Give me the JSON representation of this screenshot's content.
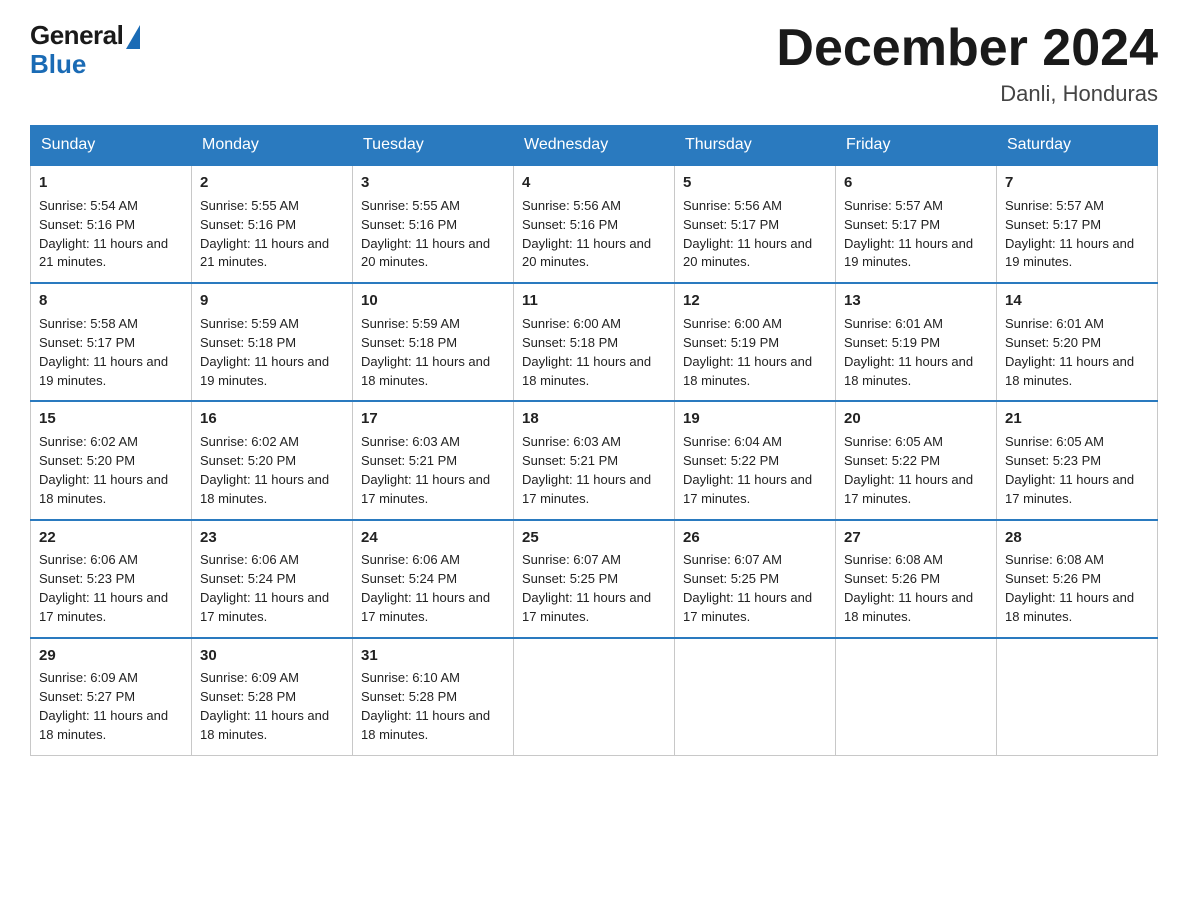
{
  "logo": {
    "general": "General",
    "blue": "Blue"
  },
  "title": "December 2024",
  "location": "Danli, Honduras",
  "days_of_week": [
    "Sunday",
    "Monday",
    "Tuesday",
    "Wednesday",
    "Thursday",
    "Friday",
    "Saturday"
  ],
  "weeks": [
    [
      {
        "day": "1",
        "sunrise": "5:54 AM",
        "sunset": "5:16 PM",
        "daylight": "11 hours and 21 minutes."
      },
      {
        "day": "2",
        "sunrise": "5:55 AM",
        "sunset": "5:16 PM",
        "daylight": "11 hours and 21 minutes."
      },
      {
        "day": "3",
        "sunrise": "5:55 AM",
        "sunset": "5:16 PM",
        "daylight": "11 hours and 20 minutes."
      },
      {
        "day": "4",
        "sunrise": "5:56 AM",
        "sunset": "5:16 PM",
        "daylight": "11 hours and 20 minutes."
      },
      {
        "day": "5",
        "sunrise": "5:56 AM",
        "sunset": "5:17 PM",
        "daylight": "11 hours and 20 minutes."
      },
      {
        "day": "6",
        "sunrise": "5:57 AM",
        "sunset": "5:17 PM",
        "daylight": "11 hours and 19 minutes."
      },
      {
        "day": "7",
        "sunrise": "5:57 AM",
        "sunset": "5:17 PM",
        "daylight": "11 hours and 19 minutes."
      }
    ],
    [
      {
        "day": "8",
        "sunrise": "5:58 AM",
        "sunset": "5:17 PM",
        "daylight": "11 hours and 19 minutes."
      },
      {
        "day": "9",
        "sunrise": "5:59 AM",
        "sunset": "5:18 PM",
        "daylight": "11 hours and 19 minutes."
      },
      {
        "day": "10",
        "sunrise": "5:59 AM",
        "sunset": "5:18 PM",
        "daylight": "11 hours and 18 minutes."
      },
      {
        "day": "11",
        "sunrise": "6:00 AM",
        "sunset": "5:18 PM",
        "daylight": "11 hours and 18 minutes."
      },
      {
        "day": "12",
        "sunrise": "6:00 AM",
        "sunset": "5:19 PM",
        "daylight": "11 hours and 18 minutes."
      },
      {
        "day": "13",
        "sunrise": "6:01 AM",
        "sunset": "5:19 PM",
        "daylight": "11 hours and 18 minutes."
      },
      {
        "day": "14",
        "sunrise": "6:01 AM",
        "sunset": "5:20 PM",
        "daylight": "11 hours and 18 minutes."
      }
    ],
    [
      {
        "day": "15",
        "sunrise": "6:02 AM",
        "sunset": "5:20 PM",
        "daylight": "11 hours and 18 minutes."
      },
      {
        "day": "16",
        "sunrise": "6:02 AM",
        "sunset": "5:20 PM",
        "daylight": "11 hours and 18 minutes."
      },
      {
        "day": "17",
        "sunrise": "6:03 AM",
        "sunset": "5:21 PM",
        "daylight": "11 hours and 17 minutes."
      },
      {
        "day": "18",
        "sunrise": "6:03 AM",
        "sunset": "5:21 PM",
        "daylight": "11 hours and 17 minutes."
      },
      {
        "day": "19",
        "sunrise": "6:04 AM",
        "sunset": "5:22 PM",
        "daylight": "11 hours and 17 minutes."
      },
      {
        "day": "20",
        "sunrise": "6:05 AM",
        "sunset": "5:22 PM",
        "daylight": "11 hours and 17 minutes."
      },
      {
        "day": "21",
        "sunrise": "6:05 AM",
        "sunset": "5:23 PM",
        "daylight": "11 hours and 17 minutes."
      }
    ],
    [
      {
        "day": "22",
        "sunrise": "6:06 AM",
        "sunset": "5:23 PM",
        "daylight": "11 hours and 17 minutes."
      },
      {
        "day": "23",
        "sunrise": "6:06 AM",
        "sunset": "5:24 PM",
        "daylight": "11 hours and 17 minutes."
      },
      {
        "day": "24",
        "sunrise": "6:06 AM",
        "sunset": "5:24 PM",
        "daylight": "11 hours and 17 minutes."
      },
      {
        "day": "25",
        "sunrise": "6:07 AM",
        "sunset": "5:25 PM",
        "daylight": "11 hours and 17 minutes."
      },
      {
        "day": "26",
        "sunrise": "6:07 AM",
        "sunset": "5:25 PM",
        "daylight": "11 hours and 17 minutes."
      },
      {
        "day": "27",
        "sunrise": "6:08 AM",
        "sunset": "5:26 PM",
        "daylight": "11 hours and 18 minutes."
      },
      {
        "day": "28",
        "sunrise": "6:08 AM",
        "sunset": "5:26 PM",
        "daylight": "11 hours and 18 minutes."
      }
    ],
    [
      {
        "day": "29",
        "sunrise": "6:09 AM",
        "sunset": "5:27 PM",
        "daylight": "11 hours and 18 minutes."
      },
      {
        "day": "30",
        "sunrise": "6:09 AM",
        "sunset": "5:28 PM",
        "daylight": "11 hours and 18 minutes."
      },
      {
        "day": "31",
        "sunrise": "6:10 AM",
        "sunset": "5:28 PM",
        "daylight": "11 hours and 18 minutes."
      },
      null,
      null,
      null,
      null
    ]
  ],
  "labels": {
    "sunrise": "Sunrise:",
    "sunset": "Sunset:",
    "daylight": "Daylight:"
  }
}
